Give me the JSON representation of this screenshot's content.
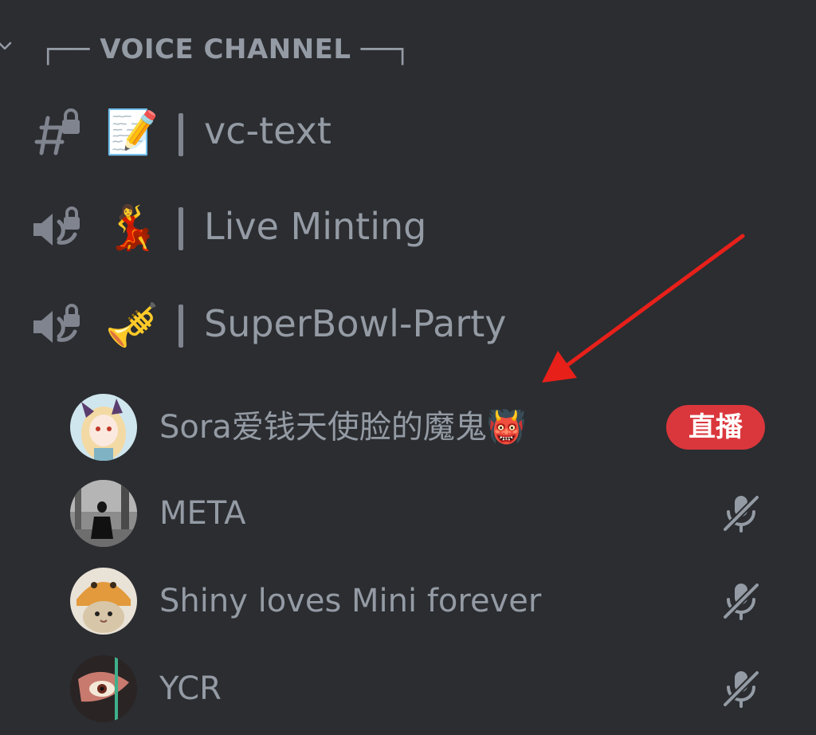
{
  "category": {
    "label": "┌── VOICE CHANNEL ──┐",
    "collapsed": false
  },
  "channels": [
    {
      "type": "text-locked",
      "icon": "locked-hash-icon",
      "emoji": "📝",
      "separator": "|",
      "name": "vc-text"
    },
    {
      "type": "voice-locked",
      "icon": "locked-speaker-icon",
      "emoji": "💃",
      "separator": "|",
      "name": "Live Minting"
    },
    {
      "type": "voice-locked",
      "icon": "locked-speaker-icon",
      "emoji": "🎺",
      "separator": "|",
      "name": "SuperBowl-Party"
    }
  ],
  "voice_users": [
    {
      "name": "Sora爱钱天使脸的魔鬼👹",
      "badge": "直播",
      "muted": false
    },
    {
      "name": "META",
      "muted": true
    },
    {
      "name": "Shiny loves Mini forever",
      "muted": true
    },
    {
      "name": "YCR",
      "muted": true
    }
  ],
  "colors": {
    "background": "#2b2d31",
    "muted_text": "#949ba4",
    "live_badge": "#da373c",
    "annotation_arrow": "#e8201a"
  }
}
